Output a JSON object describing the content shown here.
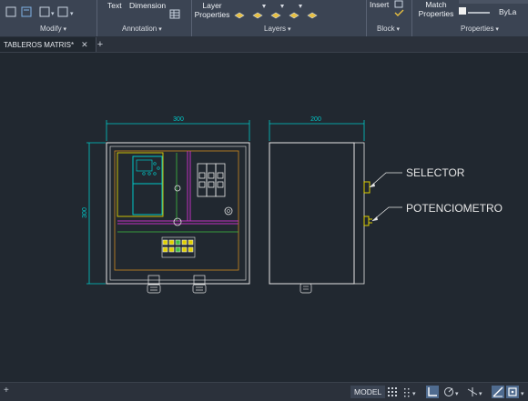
{
  "app": {
    "tab_label": "TABLEROS MATRIS*",
    "close_glyph": "✕",
    "add_tab_glyph": "+"
  },
  "ribbon": {
    "groups": {
      "modify": "Modify",
      "annotation": "Annotation",
      "layers": "Layers",
      "block": "Block",
      "properties": "Properties"
    },
    "text_btn": "Text",
    "dimension_btn": "Dimension",
    "layer_properties": [
      "Layer",
      "Properties"
    ],
    "insert_btn": "Insert",
    "match_properties": [
      "Match",
      "Properties"
    ],
    "bylayer": "ByLa"
  },
  "drawing": {
    "dim_front_width": "300",
    "dim_side_width": "200",
    "dim_front_height": "300",
    "callout_selector": "SELECTOR",
    "callout_potenciometro": "POTENCIOMETRO"
  },
  "statusbar": {
    "model": "MODEL",
    "plus": "+"
  },
  "colors": {
    "ribbon_bg": "#3b4453",
    "canvas_bg": "#212830",
    "cyan_dim": "#00c8c8",
    "magenta": "#c030c0",
    "orange": "#d08a20",
    "yellow": "#e0d000"
  }
}
